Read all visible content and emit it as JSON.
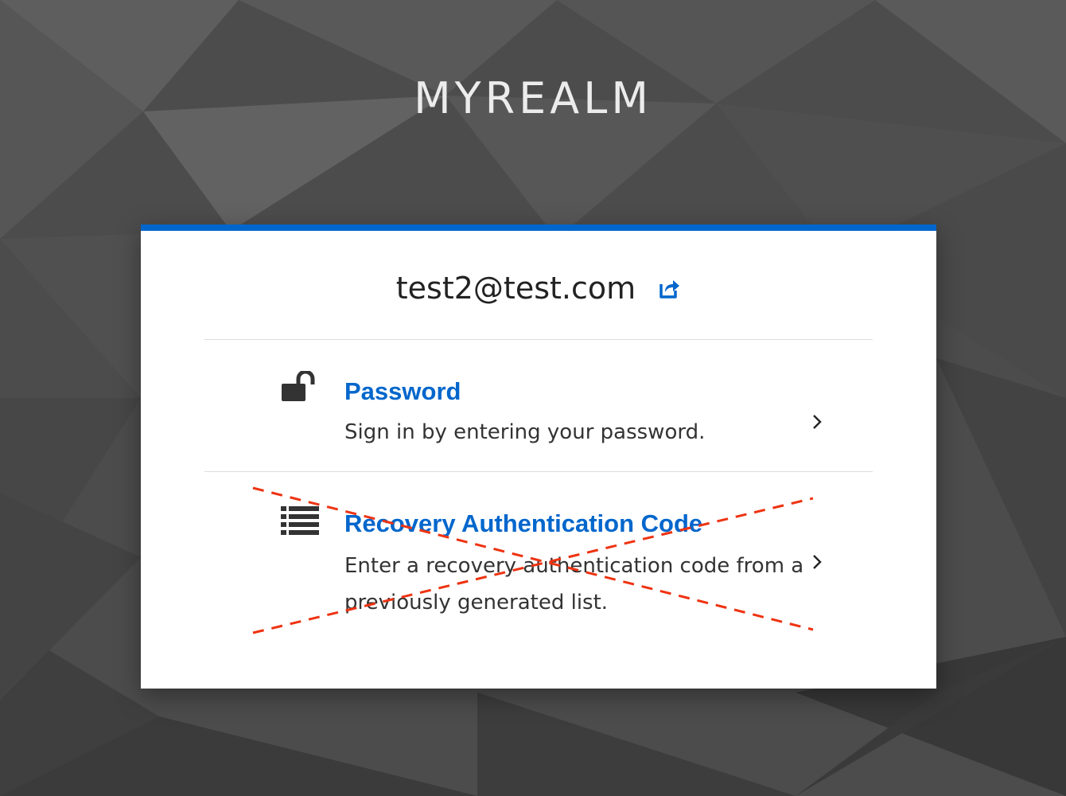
{
  "realm": {
    "title": "MYREALM"
  },
  "user": {
    "username": "test2@test.com",
    "reset_icon": "share-arrow-icon"
  },
  "methods": [
    {
      "title": "Password",
      "description": "Sign in by entering your password.",
      "icon": "unlock-icon",
      "disabled": false
    },
    {
      "title": "Recovery Authentication Code",
      "description": "Enter a recovery authentication code from a previously generated list.",
      "icon": "list-icon",
      "disabled": true
    }
  ],
  "colors": {
    "accent": "#0066cc",
    "background": "#4a4a4a",
    "strike": "#ee3311"
  }
}
